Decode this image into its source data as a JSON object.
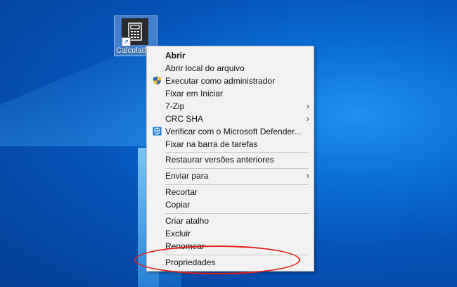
{
  "desktop": {
    "icon_label": "Calculado",
    "accent_highlight": "#e0211b"
  },
  "context_menu": {
    "items": [
      {
        "label": "Abrir",
        "bold": true
      },
      {
        "label": "Abrir local do arquivo"
      },
      {
        "label": "Executar como administrador",
        "icon": "uac-shield-icon"
      },
      {
        "label": "Fixar em Iniciar"
      },
      {
        "label": "7-Zip",
        "submenu": true
      },
      {
        "label": "CRC SHA",
        "submenu": true
      },
      {
        "label": "Verificar com o Microsoft Defender...",
        "icon": "defender-icon"
      },
      {
        "label": "Fixar na barra de tarefas"
      },
      {
        "label": "Restaurar versões anteriores"
      },
      {
        "label": "Enviar para",
        "submenu": true
      },
      {
        "label": "Recortar"
      },
      {
        "label": "Copiar"
      },
      {
        "label": "Criar atalho"
      },
      {
        "label": "Excluir"
      },
      {
        "label": "Renomear"
      },
      {
        "label": "Propriedades"
      }
    ]
  }
}
